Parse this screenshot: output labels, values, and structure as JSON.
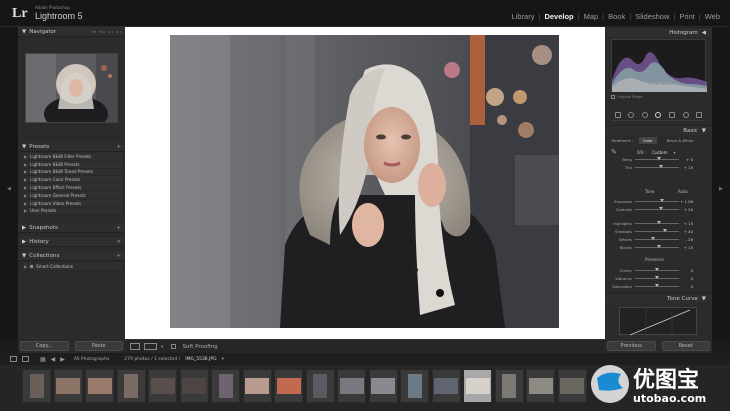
{
  "app": {
    "logo": "Lr",
    "subtitle": "Adobe Photoshop",
    "name": "Lightroom 5"
  },
  "modules": [
    {
      "label": "Library",
      "active": false
    },
    {
      "label": "Develop",
      "active": true
    },
    {
      "label": "Map",
      "active": false
    },
    {
      "label": "Book",
      "active": false
    },
    {
      "label": "Slideshow",
      "active": false
    },
    {
      "label": "Print",
      "active": false
    },
    {
      "label": "Web",
      "active": false
    }
  ],
  "left_panel": {
    "navigator": {
      "title": "Navigator",
      "options": [
        "FIT",
        "FILL",
        "1:1",
        "3:1"
      ]
    },
    "presets": {
      "title": "Presets",
      "items": [
        "Lightroom B&W Filter Presets",
        "Lightroom B&W Presets",
        "Lightroom B&W Toned Presets",
        "Lightroom Color Presets",
        "Lightroom Effect Presets",
        "Lightroom General Presets",
        "Lightroom Video Presets",
        "User Presets"
      ]
    },
    "snapshots": {
      "title": "Snapshots"
    },
    "history": {
      "title": "History"
    },
    "collections": {
      "title": "Collections",
      "items": [
        "Smart Collections"
      ]
    },
    "copy_label": "Copy...",
    "paste_label": "Paste"
  },
  "toolbar": {
    "soft_proofing": "Soft Proofing"
  },
  "right_panel": {
    "histogram": {
      "title": "Histogram",
      "readout": [
        "R 37.1",
        "G 37.4",
        "B 38.5 %"
      ],
      "original_photo": "Original Photo"
    },
    "basic": {
      "title": "Basic",
      "treatment": [
        "Treatment :",
        "Color",
        "Black & White"
      ],
      "wb_label": "WB :",
      "wb_value": "Custom",
      "tone_label": "Tone",
      "auto_label": "Auto",
      "presence_label": "Presence",
      "sliders": [
        {
          "label": "Temp",
          "value": "+ 5",
          "pos": 0.55
        },
        {
          "label": "Tint",
          "value": "+ 15",
          "pos": 0.58
        },
        {
          "label": "Exposure",
          "value": "+ 1.06",
          "pos": 0.62
        },
        {
          "label": "Contrast",
          "value": "+ 20",
          "pos": 0.58
        },
        {
          "label": "Highlights",
          "value": "+ 15",
          "pos": 0.55
        },
        {
          "label": "Shadows",
          "value": "+ 40",
          "pos": 0.68
        },
        {
          "label": "Whites",
          "value": "- 26",
          "pos": 0.4
        },
        {
          "label": "Blacks",
          "value": "+ 15",
          "pos": 0.55
        },
        {
          "label": "Clarity",
          "value": "0",
          "pos": 0.5
        },
        {
          "label": "Vibrance",
          "value": "0",
          "pos": 0.5
        },
        {
          "label": "Saturation",
          "value": "0",
          "pos": 0.5
        }
      ]
    },
    "tone_curve": {
      "title": "Tone Curve"
    },
    "previous_label": "Previous",
    "reset_label": "Reset"
  },
  "filmstrip": {
    "source": "All Photographs",
    "info": "279 photos / 1 selected /",
    "filename": "IMG_5536.JPG",
    "selected_index": 14
  },
  "watermark": {
    "chinese": "优图宝",
    "latin": "utobao.com"
  }
}
